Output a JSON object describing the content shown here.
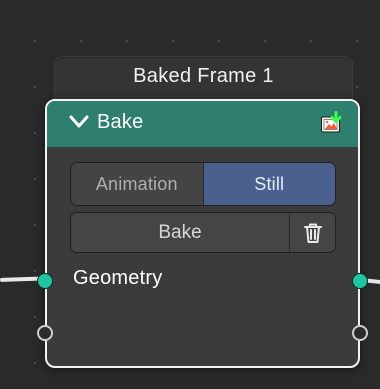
{
  "frame": {
    "label": "Baked Frame 1"
  },
  "node": {
    "title": "Bake",
    "header_color": "#2f7f6f",
    "header_icons": {
      "collapse": "chevron-down-icon",
      "bake_status": "bake-status-icon"
    },
    "mode_buttons": {
      "animation_label": "Animation",
      "still_label": "Still",
      "selected": "Still"
    },
    "actions": {
      "bake_label": "Bake",
      "delete_icon": "trash-icon"
    },
    "sockets": {
      "geometry_label": "Geometry",
      "geometry_color": "#1fc4a0"
    }
  }
}
